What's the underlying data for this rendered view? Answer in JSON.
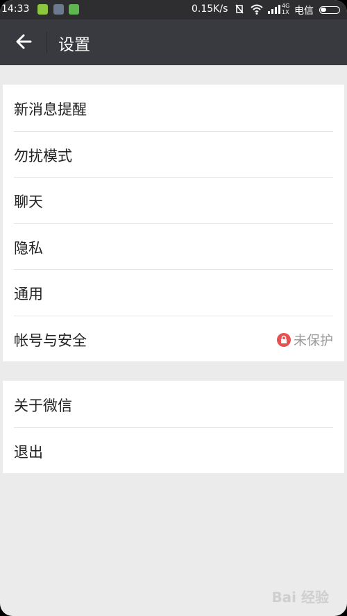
{
  "status_bar": {
    "time": "14:33",
    "speed": "0.15K/s",
    "network_type": "4G 1X",
    "carrier": "电信"
  },
  "toolbar": {
    "title": "设置"
  },
  "settings_group1": [
    {
      "label": "新消息提醒"
    },
    {
      "label": "勿扰模式"
    },
    {
      "label": "聊天"
    },
    {
      "label": "隐私"
    },
    {
      "label": "通用"
    },
    {
      "label": "帐号与安全",
      "status": "未保护"
    }
  ],
  "settings_group2": [
    {
      "label": "关于微信"
    },
    {
      "label": "退出"
    }
  ],
  "watermark": "Bai 经验",
  "colors": {
    "toolbar_bg": "#393a3f",
    "status_bar_bg": "#2e2e30",
    "page_bg": "#ebebeb",
    "lock_badge": "#e65050"
  }
}
